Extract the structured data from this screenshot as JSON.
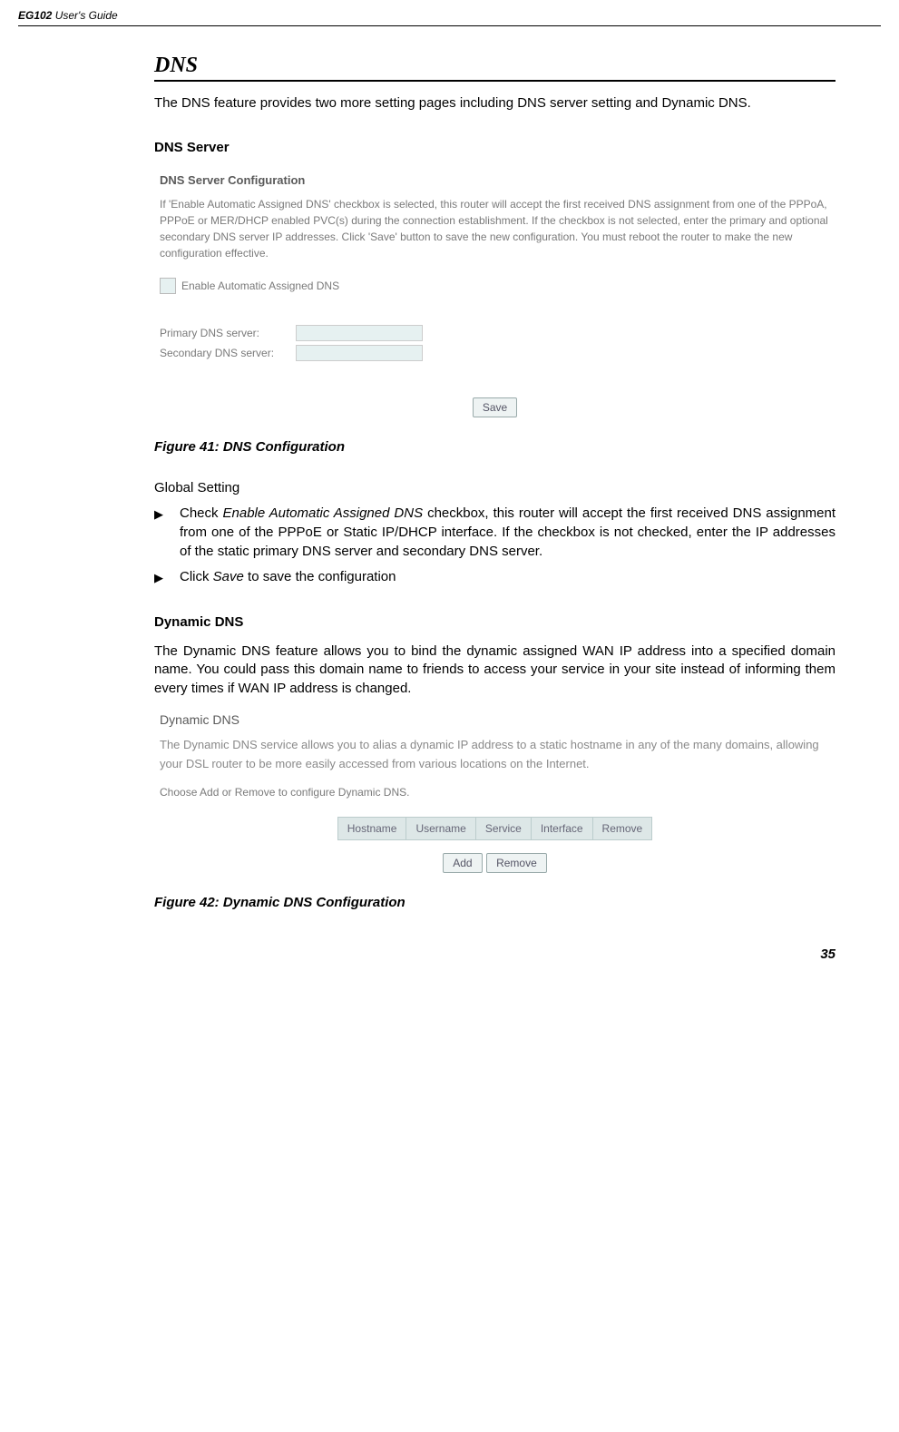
{
  "header": {
    "model": "EG102",
    "suffix": " User's Guide"
  },
  "section": {
    "title": "DNS",
    "intro": "The DNS feature provides two more setting pages including DNS server setting and Dynamic DNS."
  },
  "dns_server": {
    "heading": "DNS Server",
    "panel": {
      "title": "DNS Server Configuration",
      "desc": "If 'Enable Automatic Assigned DNS' checkbox is selected, this router will accept the first received DNS assignment from one of the PPPoA, PPPoE or MER/DHCP enabled PVC(s) during the connection establishment. If the checkbox is not selected, enter the primary and optional secondary DNS server IP addresses. Click 'Save' button to save the new configuration. You must reboot the router to make the new configuration effective.",
      "checkbox_label": "Enable Automatic Assigned DNS",
      "primary_label": "Primary DNS server:",
      "secondary_label": "Secondary DNS server:",
      "save_btn": "Save"
    },
    "caption": "Figure 41: DNS Configuration",
    "global_setting": "Global Setting",
    "bullet1_pre": "Check ",
    "bullet1_em": "Enable Automatic Assigned DNS",
    "bullet1_post": " checkbox, this router will accept the first received DNS assignment from one of the PPPoE or Static IP/DHCP interface. If the checkbox is not checked, enter the IP addresses of the static primary DNS server and secondary DNS server.",
    "bullet2_pre": "Click ",
    "bullet2_em": "Save",
    "bullet2_post": " to save the configuration"
  },
  "ddns": {
    "heading": "Dynamic DNS",
    "intro": "The Dynamic DNS feature allows you to bind the dynamic assigned WAN IP address into a specified domain name. You could pass this domain name to friends to access your service in your site instead of informing them every times if WAN IP address is changed.",
    "panel": {
      "title": "Dynamic DNS",
      "desc": "The Dynamic DNS service allows you to alias a dynamic IP address to a static hostname in any of the many domains, allowing your DSL router to be more easily accessed from various locations on the Internet.",
      "choose": "Choose Add or Remove to configure Dynamic DNS.",
      "cols": [
        "Hostname",
        "Username",
        "Service",
        "Interface",
        "Remove"
      ],
      "add_btn": "Add",
      "remove_btn": "Remove"
    },
    "caption": "Figure 42: Dynamic DNS Configuration"
  },
  "page_number": "35"
}
